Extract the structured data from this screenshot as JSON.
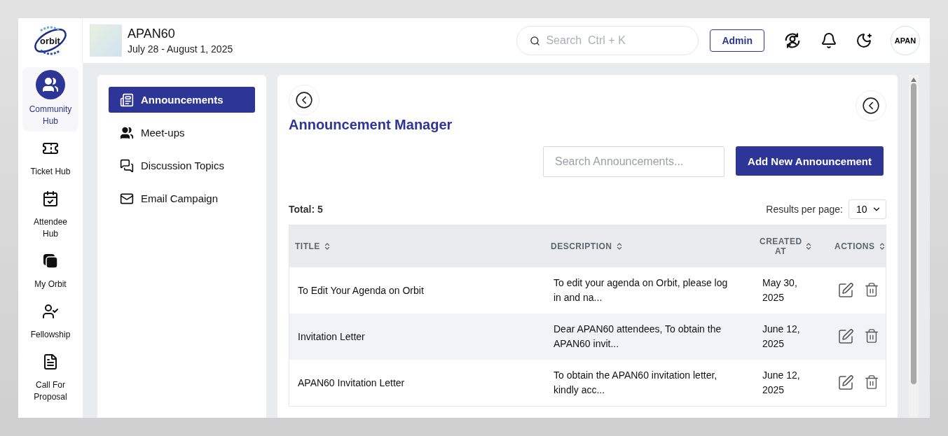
{
  "logo": {
    "text": "orbit"
  },
  "event": {
    "title": "APAN60",
    "dates": "July 28 - August 1, 2025"
  },
  "search": {
    "placeholder": "Search  Ctrl + K"
  },
  "admin_button": "Admin",
  "avatar": {
    "text": "APAN"
  },
  "rail": [
    {
      "kind": "community",
      "label": "Community Hub",
      "selected": true
    },
    {
      "kind": "ticket",
      "label": "Ticket Hub",
      "selected": false
    },
    {
      "kind": "attendee",
      "label": "Attendee Hub",
      "selected": false
    },
    {
      "kind": "orbit",
      "label": "My Orbit",
      "selected": false
    },
    {
      "kind": "fellowship",
      "label": "Fellowship",
      "selected": false
    },
    {
      "kind": "proposal",
      "label": "Call For Proposal",
      "selected": false
    }
  ],
  "submenu": [
    {
      "kind": "news",
      "label": "Announcements",
      "selected": true
    },
    {
      "kind": "people",
      "label": "Meet-ups",
      "selected": false
    },
    {
      "kind": "chat",
      "label": "Discussion Topics",
      "selected": false
    },
    {
      "kind": "mail",
      "label": "Email Campaign",
      "selected": false
    }
  ],
  "manager": {
    "title": "Announcement Manager",
    "search_placeholder": "Search Announcements...",
    "add_button": "Add New Announcement",
    "total": "Total: 5",
    "per_page_label": "Results per page:",
    "per_page": "10"
  },
  "table": {
    "columns": [
      "TITLE",
      "DESCRIPTION",
      "CREATED AT",
      "ACTIONS"
    ],
    "rows": [
      {
        "title": "To Edit Your Agenda on Orbit",
        "description": "To edit your agenda on Orbit, please log in and na...",
        "created": "May 30, 2025"
      },
      {
        "title": "Invitation Letter",
        "description": "Dear APAN60 attendees, To obtain the APAN60 invit...",
        "created": "June 12, 2025"
      },
      {
        "title": "APAN60 Invitation Letter",
        "description": "To obtain the APAN60 invitation letter, kindly acc...",
        "created": "June 12, 2025"
      }
    ]
  }
}
